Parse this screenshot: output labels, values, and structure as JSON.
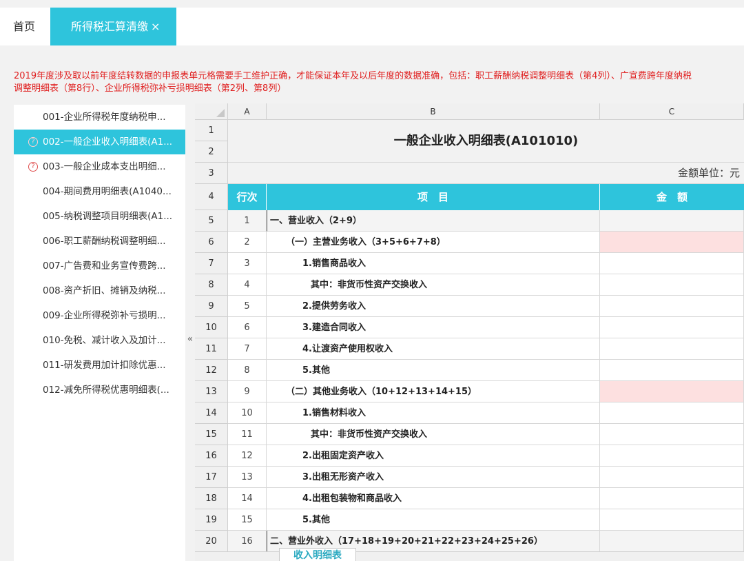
{
  "tabs": {
    "home": "首页",
    "active": "所得税汇算清缴",
    "close": "×"
  },
  "notice": "2019年度涉及取以前年度结转数据的申报表单元格需要手工维护正确，才能保证本年及以后年度的数据准确，包括：职工薪酬纳税调整明细表（第4列）、广宣费跨年度纳税调整明细表（第8行）、企业所得税弥补亏损明细表（第2列、第8列）",
  "sidebar": {
    "collapse_icon": "«",
    "items": [
      {
        "label": "001-企业所得税年度纳税申...",
        "status": ""
      },
      {
        "label": "002-一般企业收入明细表(A1...",
        "status": "?"
      },
      {
        "label": "003-一般企业成本支出明细...",
        "status": "?"
      },
      {
        "label": "004-期间费用明细表(A1040...",
        "status": ""
      },
      {
        "label": "005-纳税调整项目明细表(A1...",
        "status": ""
      },
      {
        "label": "006-职工薪酬纳税调整明细...",
        "status": ""
      },
      {
        "label": "007-广告费和业务宣传费跨...",
        "status": ""
      },
      {
        "label": "008-资产折旧、摊销及纳税...",
        "status": ""
      },
      {
        "label": "009-企业所得税弥补亏损明...",
        "status": ""
      },
      {
        "label": "010-免税、减计收入及加计...",
        "status": ""
      },
      {
        "label": "011-研发费用加计扣除优惠...",
        "status": ""
      },
      {
        "label": "012-减免所得税优惠明细表(...",
        "status": ""
      }
    ]
  },
  "sheet": {
    "col_headers": [
      "A",
      "B",
      "C"
    ],
    "row_numbers": [
      "1",
      "2",
      "3",
      "4",
      "5",
      "6",
      "7",
      "8",
      "9",
      "10",
      "11",
      "12",
      "13",
      "14",
      "15",
      "16",
      "17",
      "18",
      "19",
      "20"
    ],
    "title": "一般企业收入明细表(A101010)",
    "unit": "金额单位：元",
    "header": {
      "seq": "行次",
      "item": "项　目",
      "amount": "金　额"
    },
    "rows": [
      {
        "seq": "1",
        "item": "一、营业收入（2+9）",
        "amount": "",
        "indent": 0,
        "style": "grey"
      },
      {
        "seq": "2",
        "item": "（一）主营业务收入（3+5+6+7+8）",
        "amount": "",
        "indent": 1,
        "style": "pink"
      },
      {
        "seq": "3",
        "item": "1.销售商品收入",
        "amount": "",
        "indent": 2,
        "style": ""
      },
      {
        "seq": "4",
        "item": "其中：非货币性资产交换收入",
        "amount": "",
        "indent": 3,
        "style": ""
      },
      {
        "seq": "5",
        "item": "2.提供劳务收入",
        "amount": "",
        "indent": 2,
        "style": ""
      },
      {
        "seq": "6",
        "item": "3.建造合同收入",
        "amount": "",
        "indent": 2,
        "style": ""
      },
      {
        "seq": "7",
        "item": "4.让渡资产使用权收入",
        "amount": "",
        "indent": 2,
        "style": ""
      },
      {
        "seq": "8",
        "item": "5.其他",
        "amount": "",
        "indent": 2,
        "style": ""
      },
      {
        "seq": "9",
        "item": "（二）其他业务收入（10+12+13+14+15）",
        "amount": "",
        "indent": 1,
        "style": "pink"
      },
      {
        "seq": "10",
        "item": "1.销售材料收入",
        "amount": "",
        "indent": 2,
        "style": ""
      },
      {
        "seq": "11",
        "item": "其中：非货币性资产交换收入",
        "amount": "",
        "indent": 3,
        "style": ""
      },
      {
        "seq": "12",
        "item": "2.出租固定资产收入",
        "amount": "",
        "indent": 2,
        "style": ""
      },
      {
        "seq": "13",
        "item": "3.出租无形资产收入",
        "amount": "",
        "indent": 2,
        "style": ""
      },
      {
        "seq": "14",
        "item": "4.出租包装物和商品收入",
        "amount": "",
        "indent": 2,
        "style": ""
      },
      {
        "seq": "15",
        "item": "5.其他",
        "amount": "",
        "indent": 2,
        "style": ""
      },
      {
        "seq": "16",
        "item": "二、营业外收入（17+18+19+20+21+22+23+24+25+26）",
        "amount": "",
        "indent": 0,
        "style": "grey"
      }
    ],
    "sheet_tab": "收入明细表"
  }
}
